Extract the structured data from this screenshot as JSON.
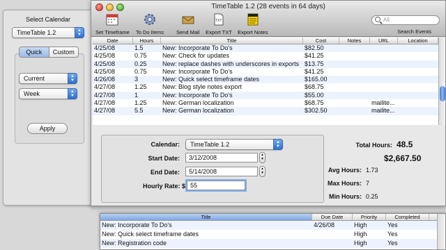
{
  "drawer": {
    "title": "Select Calendar",
    "calendar_popup": "TimeTable 1.2",
    "seg_quick": "Quick",
    "seg_custom": "Custom",
    "range_popup": "Current",
    "unit_popup": "Week",
    "apply_label": "Apply"
  },
  "window": {
    "title": "TimeTable 1.2 (28 events in 64 days)",
    "toolbar": {
      "set_timeframe": "Set Timeframe",
      "todo_items": "To Do Items",
      "send_mail": "Send Mail",
      "export_txt": "Export TXT",
      "export_notes": "Export Notes"
    },
    "search_placeholder": "All",
    "search_label": "Search Events"
  },
  "table": {
    "headers": [
      "Date",
      "Hours",
      "Title",
      "Cost",
      "Notes",
      "URL",
      "Location"
    ],
    "rows": [
      [
        "4/25/08",
        "1.5",
        "New: Incorporate To Do's",
        "$82.50",
        "",
        "",
        ""
      ],
      [
        "4/25/08",
        "0.75",
        "New: Check for updates",
        "$41.25",
        "",
        "",
        ""
      ],
      [
        "4/25/08",
        "0.25",
        "New: replace dashes with underscores in exports",
        "$13.75",
        "",
        "",
        ""
      ],
      [
        "4/25/08",
        "0.75",
        "New: Incorporate To Do's",
        "$41.25",
        "",
        "",
        ""
      ],
      [
        "4/26/08",
        "3",
        "New: Quick select timeframe dates",
        "$165.00",
        "",
        "",
        ""
      ],
      [
        "4/27/08",
        "1.25",
        "New: Blog style notes export",
        "$68.75",
        "",
        "",
        ""
      ],
      [
        "4/27/08",
        "1",
        "New: Incorporate To Do's",
        "$55.00",
        "",
        "",
        ""
      ],
      [
        "4/27/08",
        "1.25",
        "New: German localization",
        "$68.75",
        "",
        "mailite...",
        ""
      ],
      [
        "4/27/08",
        "5.5",
        "New: German localization",
        "$302.50",
        "",
        "mailite...",
        ""
      ]
    ]
  },
  "detail": {
    "calendar_label": "Calendar:",
    "calendar_value": "TimeTable 1.2",
    "start_label": "Start Date:",
    "start_value": "3/12/2008",
    "end_label": "End Date:",
    "end_value": "5/14/2008",
    "rate_label": "Hourly Rate: $",
    "rate_value": "55",
    "total_hours_label": "Total Hours:",
    "total_hours_value": "48.5",
    "total_cost": "$2,667.50",
    "avg_label": "Avg Hours:",
    "avg_value": "1.73",
    "max_label": "Max Hours:",
    "max_value": "7",
    "min_label": "Min Hours:",
    "min_value": "0.25"
  },
  "todo": {
    "headers": [
      "Title",
      "Due Date",
      "Priority",
      "Completed"
    ],
    "rows": [
      [
        "New: Incorporate To Do's",
        "4/26/08",
        "High",
        "Yes"
      ],
      [
        "New: Quick select timeframe dates",
        "",
        "High",
        "Yes"
      ],
      [
        "New: Registration code",
        "",
        "High",
        "Yes"
      ]
    ]
  }
}
